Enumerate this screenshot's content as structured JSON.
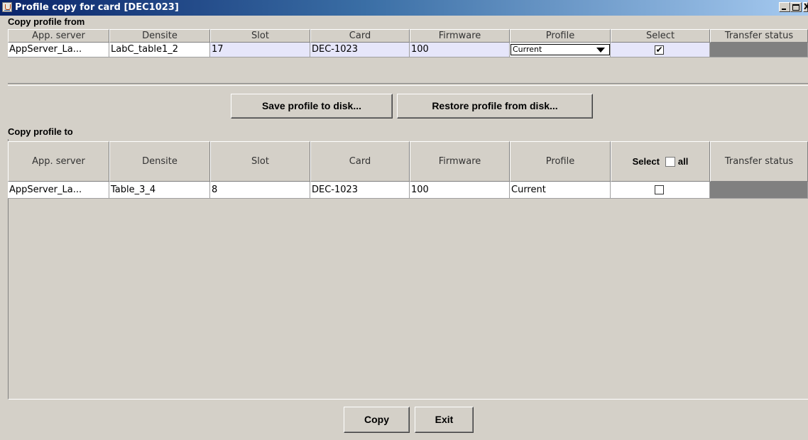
{
  "window": {
    "title": "Profile copy for card [DEC1023]",
    "icon": "java-cup-icon"
  },
  "columns": [
    "App. server",
    "Densite",
    "Slot",
    "Card",
    "Firmware",
    "Profile",
    "Select",
    "Transfer status"
  ],
  "from_section": {
    "label": "Copy profile from",
    "row": {
      "app_server": "AppServer_La...",
      "densite": "LabC_table1_2",
      "slot": "17",
      "card": "DEC-1023",
      "firmware": "100",
      "profile": "Current",
      "selected": "✔",
      "transfer_status": ""
    }
  },
  "disk_buttons": {
    "save": "Save profile to disk...",
    "restore": "Restore profile from disk..."
  },
  "to_section": {
    "label": "Copy profile to",
    "select_header": "Select",
    "select_all_label": "all",
    "row": {
      "app_server": "AppServer_La...",
      "densite": "Table_3_4",
      "slot": "8",
      "card": "DEC-1023",
      "firmware": "100",
      "profile": "Current",
      "selected": "",
      "transfer_status": ""
    }
  },
  "footer": {
    "copy": "Copy",
    "exit": "Exit"
  },
  "colors": {
    "background": "#d4d0c8",
    "title_bar_start": "#0a246a",
    "title_bar_end": "#a6caf0",
    "selected_row": "#e6e6fa",
    "transfer_status_fill": "#808080"
  }
}
